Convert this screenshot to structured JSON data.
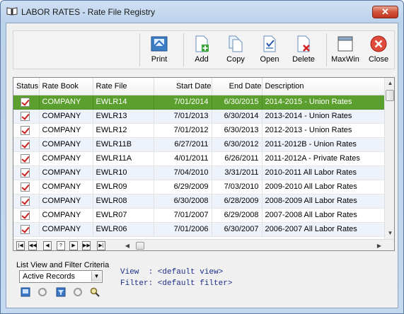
{
  "window": {
    "title": "LABOR RATES - Rate File Registry"
  },
  "toolbar": {
    "print": "Print",
    "add": "Add",
    "copy": "Copy",
    "open": "Open",
    "delete": "Delete",
    "maxwin": "MaxWin",
    "close": "Close"
  },
  "table": {
    "columns": [
      "Status",
      "Rate Book",
      "Rate File",
      "Start Date",
      "End Date",
      "Description"
    ],
    "rows": [
      {
        "status": true,
        "rate_book": "COMPANY",
        "rate_file": "EWLR14",
        "start": "7/01/2014",
        "end": "6/30/2015",
        "desc": "2014-2015 - Union Rates",
        "selected": true
      },
      {
        "status": true,
        "rate_book": "COMPANY",
        "rate_file": "EWLR13",
        "start": "7/01/2013",
        "end": "6/30/2014",
        "desc": "2013-2014 - Union Rates"
      },
      {
        "status": true,
        "rate_book": "COMPANY",
        "rate_file": "EWLR12",
        "start": "7/01/2012",
        "end": "6/30/2013",
        "desc": "2012-2013 - Union Rates"
      },
      {
        "status": true,
        "rate_book": "COMPANY",
        "rate_file": "EWLR11B",
        "start": "6/27/2011",
        "end": "6/30/2012",
        "desc": "2011-2012B - Union Rates"
      },
      {
        "status": true,
        "rate_book": "COMPANY",
        "rate_file": "EWLR11A",
        "start": "4/01/2011",
        "end": "6/26/2011",
        "desc": "2011-2012A - Private Rates"
      },
      {
        "status": true,
        "rate_book": "COMPANY",
        "rate_file": "EWLR10",
        "start": "7/04/2010",
        "end": "3/31/2011",
        "desc": "2010-2011 All Labor Rates"
      },
      {
        "status": true,
        "rate_book": "COMPANY",
        "rate_file": "EWLR09",
        "start": "6/29/2009",
        "end": "7/03/2010",
        "desc": "2009-2010 All Labor Rates"
      },
      {
        "status": true,
        "rate_book": "COMPANY",
        "rate_file": "EWLR08",
        "start": "6/30/2008",
        "end": "6/28/2009",
        "desc": "2008-2009 All Labor Rates"
      },
      {
        "status": true,
        "rate_book": "COMPANY",
        "rate_file": "EWLR07",
        "start": "7/01/2007",
        "end": "6/29/2008",
        "desc": "2007-2008 All Labor Rates"
      },
      {
        "status": true,
        "rate_book": "COMPANY",
        "rate_file": "EWLR06",
        "start": "7/01/2006",
        "end": "6/30/2007",
        "desc": "2006-2007 All Labor Rates"
      }
    ]
  },
  "nav": [
    "|◀",
    "◀◀",
    "◀",
    "?",
    "▶",
    "▶▶",
    "▶|"
  ],
  "filter": {
    "title": "List View and Filter Criteria",
    "selected": "Active Records",
    "view_line": "View  : <default view>",
    "filter_line": "Filter: <default filter>"
  },
  "colors": {
    "selected_row": "#5b9f2e",
    "alt_row": "#eef3fb",
    "check": "#cc1f1f"
  }
}
